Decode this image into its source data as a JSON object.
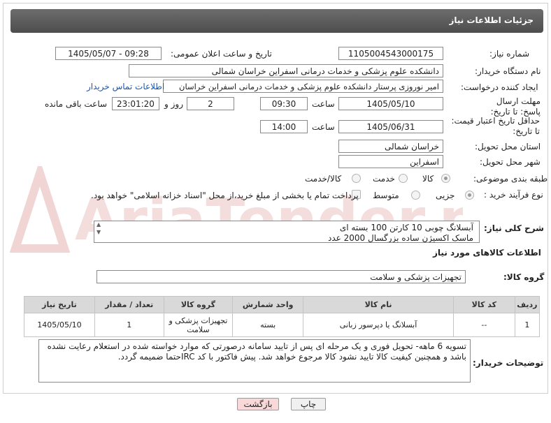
{
  "header": {
    "title": "جزئیات اطلاعات نیاز"
  },
  "fields": {
    "need_number_label": "شماره نیاز:",
    "need_number": "1105004543000175",
    "announce_label": "تاریخ و ساعت اعلان عمومی:",
    "announce_value": "1405/05/07 - 09:28",
    "buyer_org_label": "نام دستگاه خریدار:",
    "buyer_org": "دانشکده علوم پزشکی و خدمات درمانی اسفراین خراسان شمالی",
    "requester_label": "ایجاد کننده درخواست:",
    "requester": "امیر  نوروزی  پرستار  دانشکده علوم پزشکی و خدمات درمانی اسفراین خراسان",
    "contact_link": "اطلاعات تماس خریدار",
    "deadline_label": "مهلت ارسال پاسخ: تا تاریخ:",
    "deadline_date": "1405/05/10",
    "time_label": "ساعت",
    "deadline_time": "09:30",
    "days_value": "2",
    "days_label": "روز و",
    "remaining_time": "23:01:20",
    "remaining_label": "ساعت باقی مانده",
    "price_validity_label": "حداقل تاریخ اعتبار قیمت: تا تاریخ:",
    "price_validity_date": "1405/06/31",
    "price_validity_time": "14:00",
    "province_label": "استان محل تحویل:",
    "province": "خراسان شمالی",
    "city_label": "شهر محل تحویل:",
    "city": "اسفراین",
    "category_label": "طبقه بندی موضوعی:",
    "category_options": [
      "کالا",
      "خدمت",
      "کالا/خدمت"
    ],
    "process_label": "نوع فرآیند خرید :",
    "process_options": [
      "جزیی",
      "متوسط"
    ],
    "payment_note": "پرداخت تمام یا بخشی از مبلغ خرید،از محل \"اسناد خزانه اسلامی\" خواهد بود."
  },
  "description": {
    "label": "شرح کلی نیاز:",
    "lines": [
      "آبسلانگ چوبی 10 کارتن 100 بسته ای",
      "ماسک اکسیژن ساده بزرگسال 2000 عدد"
    ]
  },
  "goods_section": {
    "title": "اطلاعات کالاهای مورد نیاز",
    "group_label": "گروه کالا:",
    "group_value": "تجهیزات پزشکی و سلامت"
  },
  "table": {
    "headers": [
      "ردیف",
      "کد کالا",
      "نام کالا",
      "واحد شمارش",
      "گروه کالا",
      "تعداد / مقدار",
      "تاریخ نیاز"
    ],
    "rows": [
      [
        "1",
        "--",
        "آبسلانگ یا دپرسور زبانی",
        "بسته",
        "تجهیزات پزشکی و سلامت",
        "1",
        "1405/05/10"
      ]
    ]
  },
  "buyer_notes": {
    "label": "توضیحات خریدار:",
    "text": "تسویه 6 ماهه- تحویل فوری و یک مرحله ای پس از تایید سامانه درصورتی که موارد خواسته شده در استعلام رعایت نشده باشد و همچنین کیفیت کالا تایید نشود کالا مرجوع خواهد شد. پیش فاکتور با کد IRCحتما ضمیمه گردد."
  },
  "buttons": {
    "print": "چاپ",
    "back": "بازگشت"
  },
  "watermark": {
    "text": "AriaTender.net"
  },
  "colors": {
    "header_bg": "#5a5a5a",
    "link": "#1a56b0",
    "back_btn": "#f8d8d8",
    "watermark": "#e7b4b4"
  }
}
